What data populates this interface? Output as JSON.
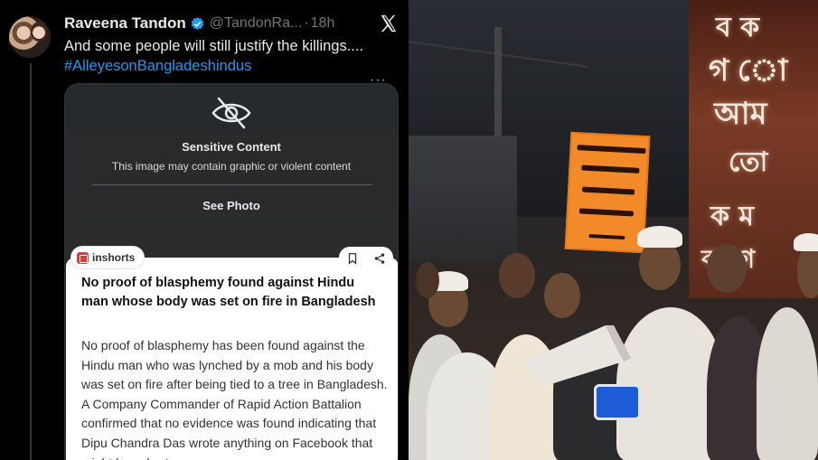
{
  "tweet": {
    "author_name": "Raveena Tandon",
    "handle": "@TandonRa...",
    "separator": "·",
    "time": "18h",
    "text": "And some people will still justify the killings....",
    "hashtag": "#AlleyesonBangladeshindus",
    "more": "···"
  },
  "media_warning": {
    "title": "Sensitive Content",
    "subtitle": "This image may contain graphic or violent content",
    "action": "See Photo"
  },
  "news_card": {
    "source": "inshorts",
    "headline": "No proof of blasphemy found against Hindu man whose body was set on fire in Bangladesh",
    "body": "No proof of blasphemy has been found against the Hindu man who was lynched by a mob and his body was set on fire after being tied to a tree in Bangladesh. A Company Commander of Rapid Action Battalion confirmed that no evidence was found indicating that Dipu Chandra Das wrote anything on Facebook that might have hurt"
  },
  "colors": {
    "accent": "#1d9bf0",
    "placard": "#f28a2a",
    "inshorts_red": "#e23b2f"
  },
  "icons": [
    "verified-badge-icon",
    "x-logo-icon",
    "eye-slash-icon",
    "bookmark-icon",
    "share-icon",
    "more-icon"
  ]
}
